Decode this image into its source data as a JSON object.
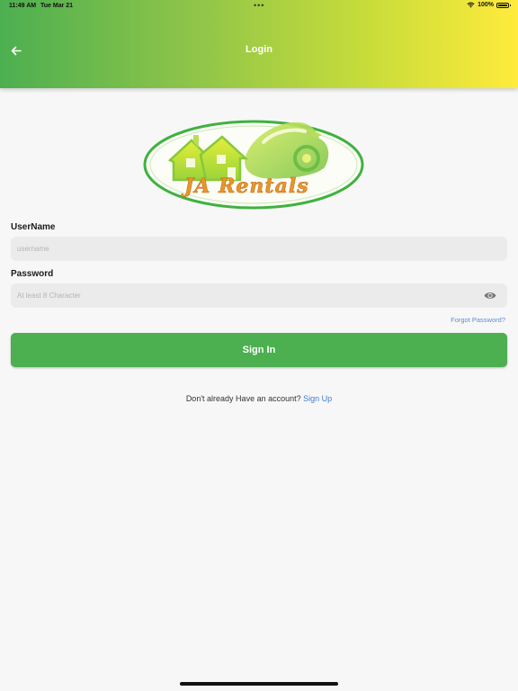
{
  "status_bar": {
    "time": "11:49 AM",
    "date": "Tue Mar 21",
    "battery": "100%"
  },
  "header": {
    "title": "Login",
    "back_icon": "arrow-left-icon"
  },
  "logo": {
    "text": "JA Rentals"
  },
  "form": {
    "username_label": "UserName",
    "username_placeholder": "username",
    "username_value": "",
    "password_label": "Password",
    "password_placeholder": "At least 8 Character",
    "password_value": "",
    "forgot_password": "Forgot Password?",
    "sign_in": "Sign In"
  },
  "signup": {
    "prompt": "Don't already Have an account?",
    "link": "Sign Up"
  },
  "colors": {
    "primary_green": "#4caf50",
    "gradient_end": "#ffeb3b",
    "link_blue": "#5b8fd6"
  }
}
